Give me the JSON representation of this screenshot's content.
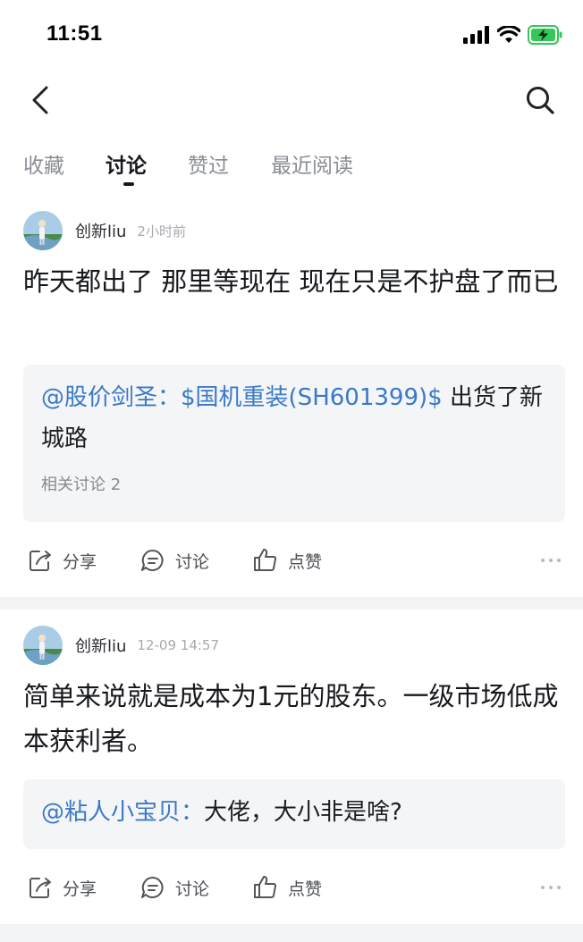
{
  "status_bar": {
    "time": "11:51"
  },
  "tabs": [
    {
      "label": "收藏",
      "active": false
    },
    {
      "label": "讨论",
      "active": true
    },
    {
      "label": "赞过",
      "active": false
    },
    {
      "label": "最近阅读",
      "active": false
    }
  ],
  "posts": [
    {
      "author": "创新liu",
      "time": "2小时前",
      "body": "昨天都出了 那里等现在 现在只是不护盘了而已",
      "quote": {
        "mention": "@股价剑圣：$国机重装(SH601399)$",
        "text": " 出货了新城路",
        "related": "相关讨论 2"
      },
      "actions": {
        "share": "分享",
        "discuss": "讨论",
        "like": "点赞"
      }
    },
    {
      "author": "创新liu",
      "time": "12-09 14:57",
      "body": "简单来说就是成本为1元的股东。一级市场低成本获利者。",
      "quote": {
        "mention": "@粘人小宝贝：",
        "text": "大佬，大小非是啥?"
      },
      "actions": {
        "share": "分享",
        "discuss": "讨论",
        "like": "点赞"
      }
    }
  ],
  "colors": {
    "link": "#3a79c8",
    "battery": "#34c759"
  },
  "icons": [
    "signal-icon",
    "wifi-icon",
    "battery-icon",
    "back-arrow-icon",
    "search-icon",
    "share-icon",
    "comment-icon",
    "like-icon",
    "more-icon"
  ]
}
